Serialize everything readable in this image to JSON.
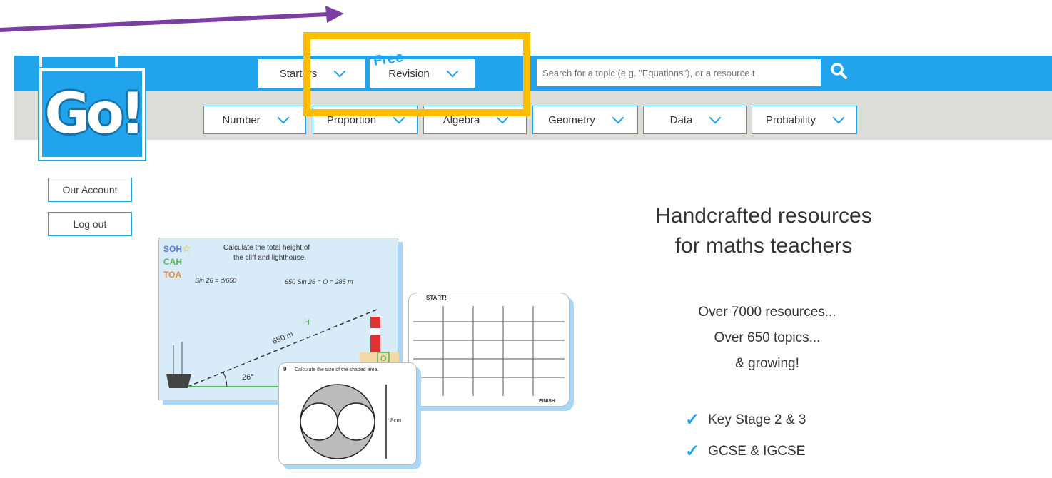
{
  "header": {
    "logo_text": "Go!",
    "top_menus": [
      {
        "label": "Starters"
      },
      {
        "label": "Revision",
        "badge": "Free"
      }
    ],
    "search": {
      "placeholder": "Search for a topic (e.g. \"Equations\"), or a resource t"
    },
    "topic_menus": [
      {
        "label": "Number"
      },
      {
        "label": "Proportion"
      },
      {
        "label": "Algebra"
      },
      {
        "label": "Geometry"
      },
      {
        "label": "Data"
      },
      {
        "label": "Probability"
      }
    ]
  },
  "account": {
    "our_account": "Our Account",
    "log_out": "Log out"
  },
  "hero": {
    "title_line1": "Handcrafted resources",
    "title_line2": "for maths teachers",
    "stat1": "Over 7000 resources...",
    "stat2": "Over 650 topics...",
    "stat3": "& growing!",
    "features": [
      "Key Stage 2 & 3",
      "GCSE & IGCSE"
    ]
  },
  "slides": {
    "soh": "SOH",
    "cah": "CAH",
    "toa": "TOA",
    "question": "Calculate the total height of",
    "question2": "the cliff and lighthouse.",
    "equation1": "Sin 26 = d/650",
    "equation2": "650 Sin 26 = O   = 285 m",
    "side_h": "H",
    "side_o": "O",
    "hyp": "650 m",
    "angle": "26°",
    "circle_q": "Calculate the size of the shaded area.",
    "circle_num": "9",
    "dim": "8cm",
    "grid_start": "START!",
    "grid_finish": "FINISH"
  },
  "colors": {
    "brand_blue": "#22a4ec",
    "highlight": "#fbbf00",
    "arrow": "#7b3fa3"
  }
}
